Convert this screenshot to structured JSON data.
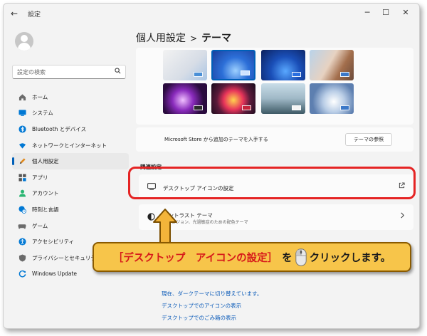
{
  "window": {
    "title": "設定",
    "back_icon": "arrow-left-icon",
    "controls": [
      "minimize-icon",
      "maximize-icon",
      "close-icon"
    ]
  },
  "sidebar": {
    "search_placeholder": "設定の検索",
    "items": [
      {
        "label": "ホーム",
        "icon": "home-icon",
        "color": "#6b6b6b"
      },
      {
        "label": "システム",
        "icon": "monitor-icon",
        "color": "#0078d4"
      },
      {
        "label": "Bluetooth とデバイス",
        "icon": "bluetooth-icon",
        "color": "#0078d4"
      },
      {
        "label": "ネットワークとインターネット",
        "icon": "wifi-icon",
        "color": "#0078d4"
      },
      {
        "label": "個人用設定",
        "icon": "pen-icon",
        "color": "#e08a1e",
        "active": true
      },
      {
        "label": "アプリ",
        "icon": "apps-icon",
        "color": "#555555"
      },
      {
        "label": "アカウント",
        "icon": "person-icon",
        "color": "#2bb673"
      },
      {
        "label": "時刻と言語",
        "icon": "globe-clock-icon",
        "color": "#0078d4"
      },
      {
        "label": "ゲーム",
        "icon": "gamepad-icon",
        "color": "#6b6b6b"
      },
      {
        "label": "アクセシビリティ",
        "icon": "accessibility-icon",
        "color": "#0078d4"
      },
      {
        "label": "プライバシーとセキュリティ",
        "icon": "shield-icon",
        "color": "#6b6b6b"
      },
      {
        "label": "Windows Update",
        "icon": "update-icon",
        "color": "#0078d4"
      }
    ]
  },
  "header": {
    "parent": "個人用設定",
    "separator": ">",
    "current": "テーマ"
  },
  "themes": {
    "store_text": "Microsoft Store から追加のテーマを入手する",
    "browse_button": "テーマの参照"
  },
  "related": {
    "section_label": "関連設定",
    "desktop_icons": "デスクトップ アイコンの設定",
    "contrast_title": "コントラスト テーマ",
    "contrast_sub": "ロービジョン、光過敏症のための配色テーマ"
  },
  "callout": {
    "bracket_open": "［",
    "target": "デスクトップ　アイコンの設定",
    "bracket_close": "］",
    "particle": "を",
    "action": "クリックします。",
    "mouse_icon": "mouse-icon"
  },
  "links": [
    "現在、ダークテーマに切り替えています。",
    "デスクトップでのアイコンの表示",
    "デスクトップでのごみ箱の表示"
  ],
  "colors": {
    "accent": "#005fb8",
    "highlight_border": "#e52424",
    "callout_bg": "#f7c54a",
    "callout_text_red": "#d71a1a",
    "arrow_fill": "#f3b43a"
  }
}
